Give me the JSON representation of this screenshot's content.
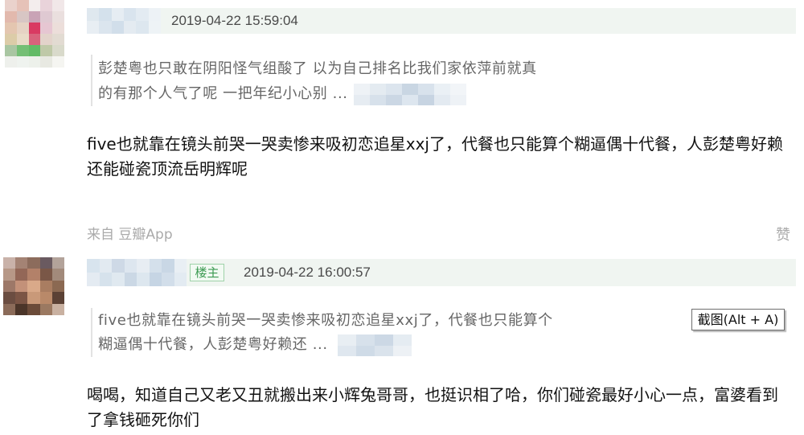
{
  "comments": [
    {
      "timestamp": "2019-04-22 15:59:04",
      "quote_lines": [
        "彭楚粤也只敢在阴阳怪气组酸了 以为自己排名比我们家依萍前就真",
        "的有那个人气了呢 一把年纪小心别 ..."
      ],
      "text_lines": [
        "five也就靠在镜头前哭一哭卖惨来吸初恋追星xxj了，代餐也只能算个糊逼偶十代餐，人彭楚粤好赖",
        "还能碰瓷顶流岳明辉呢"
      ],
      "source": "来自 豆瓣App",
      "like_label": "赞"
    },
    {
      "badge": "楼主",
      "timestamp": "2019-04-22 16:00:57",
      "quote_lines": [
        "five也就靠在镜头前哭一哭卖惨来吸初恋追星xxj了，代餐也只能算个",
        "糊逼偶十代餐，人彭楚粤好赖还 ..."
      ],
      "text_lines": [
        "喝喝，知道自己又老又丑就搬出来小辉兔哥哥，也挺识相了哈，你们碰瓷最好小心一点，富婆看到",
        "了拿钱砸死你们"
      ]
    }
  ],
  "screenshot_tooltip": "截图(Alt + A)",
  "colors": {
    "header_bg": "#f0f5f1",
    "badge_green": "#3c9a52",
    "meta_gray": "#aaaaaa",
    "quote_gray": "#666666"
  }
}
